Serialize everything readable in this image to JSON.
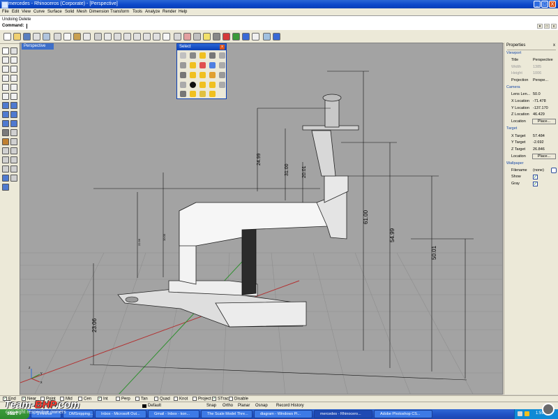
{
  "window": {
    "title": "mercedes - Rhinoceros (Corporate) - [Perspective]",
    "min_symbol": "_",
    "max_symbol": "□",
    "close_symbol": "X"
  },
  "menu": [
    "File",
    "Edit",
    "View",
    "Curve",
    "Surface",
    "Solid",
    "Mesh",
    "Dimension",
    "Transform",
    "Tools",
    "Analyze",
    "Render",
    "Help"
  ],
  "command": {
    "history": "Undoing Delete",
    "prompt": "Command:"
  },
  "viewport": {
    "tab": "Perspective",
    "axis_labels": [
      "z",
      "y",
      "x"
    ],
    "dimensions": [
      "24.99",
      "31.00",
      "20.01",
      "61.00",
      "54.99",
      "50.01",
      "23.06",
      "22.96",
      "10.00"
    ]
  },
  "select_palette": {
    "title": "Select",
    "close": "x"
  },
  "properties": {
    "title": "Properties",
    "close": "x",
    "viewport_section": "Viewport",
    "title_label": "Title",
    "title_value": "Perspective",
    "width_label": "Width",
    "width_value": "1385",
    "height_label": "Height",
    "height_value": "1006",
    "projection_label": "Projection",
    "projection_value": "Perspe...",
    "camera_section": "Camera",
    "lens_label": "Lens Len...",
    "lens_value": "50.0",
    "xloc_label": "X Location",
    "xloc_value": "-71.478",
    "yloc_label": "Y Location",
    "yloc_value": "-137.170",
    "zloc_label": "Z Location",
    "zloc_value": "46.429",
    "location_label": "Location",
    "place_button": "Place...",
    "target_section": "Target",
    "xtarget_label": "X Target",
    "xtarget_value": "57.484",
    "ytarget_label": "Y Target",
    "ytarget_value": "-2.692",
    "ztarget_label": "Z Target",
    "ztarget_value": "26.846",
    "target_location_label": "Location",
    "target_place_button": "Place...",
    "wallpaper_section": "Wallpaper",
    "filename_label": "Filename",
    "filename_value": "(none)",
    "show_label": "Show",
    "gray_label": "Gray",
    "check_mark": "✓"
  },
  "osnap": [
    "End",
    "Near",
    "Point",
    "Mid",
    "Cen",
    "Int",
    "Perp",
    "Tan",
    "Quad",
    "Knot",
    "Project",
    "STrack",
    "Disable"
  ],
  "osnap_checked": [
    true,
    true,
    false,
    false,
    false,
    true,
    false,
    false,
    false,
    false,
    false,
    true,
    false
  ],
  "status": {
    "layer": "Default",
    "snap": "Snap",
    "ortho": "Ortho",
    "planar": "Planar",
    "osnap": "Osnap",
    "record_history": "Record History"
  },
  "taskbar": {
    "start": "start",
    "tasks": [
      "3 Firefox",
      "DMSnipping...",
      "Inbox - Microsoft Out...",
      "Gmail - Inbox - kon...",
      "The Scale Model Thre...",
      "diagram - Windows Pi...",
      "mercedes - Rhinocero...",
      "Adobe Photoshop CS..."
    ],
    "clock": "1:59 AM"
  },
  "watermark": {
    "team": "Team-",
    "bhp": "BHP",
    "com": ".com",
    "copyright": "copyright respective owners"
  }
}
